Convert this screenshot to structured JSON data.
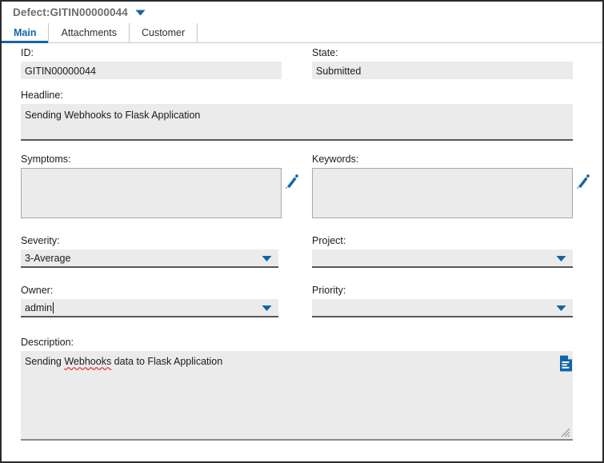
{
  "window": {
    "title": "Defect:GITIN00000044",
    "title_caret_icon": "chevron-down-icon"
  },
  "tabs": [
    {
      "label": "Main",
      "active": true
    },
    {
      "label": "Attachments",
      "active": false
    },
    {
      "label": "Customer",
      "active": false
    }
  ],
  "form": {
    "id": {
      "label": "ID:",
      "value": "GITIN00000044",
      "readonly": true
    },
    "state": {
      "label": "State:",
      "value": "Submitted",
      "readonly": true
    },
    "headline": {
      "label": "Headline:",
      "value": "Sending Webhooks to Flask Application"
    },
    "symptoms": {
      "label": "Symptoms:",
      "value": "",
      "edit_icon": "pencil-edit-icon"
    },
    "keywords": {
      "label": "Keywords:",
      "value": "",
      "edit_icon": "pencil-edit-icon"
    },
    "severity": {
      "label": "Severity:",
      "value": "3-Average",
      "caret_icon": "chevron-down-icon"
    },
    "project": {
      "label": "Project:",
      "value": "",
      "caret_icon": "chevron-down-icon"
    },
    "owner": {
      "label": "Owner:",
      "value": "admin",
      "focused": true,
      "caret_icon": "chevron-down-icon"
    },
    "priority": {
      "label": "Priority:",
      "value": "",
      "caret_icon": "chevron-down-icon"
    },
    "description": {
      "label": "Description:",
      "text_before": "Sending ",
      "text_misspelled": "Webhooks",
      "text_after": " data to Flask Application",
      "doc_icon": "document-icon",
      "resize_handle_icon": "resize-grip-icon"
    }
  },
  "colors": {
    "accent": "#1464a5",
    "field_bg": "#ebebeb",
    "field_border": "#a8a8a8",
    "underline": "#575757",
    "spell_error": "#e03b2f",
    "frame": "#2b2b2b",
    "title_text": "#6d6d6d"
  }
}
